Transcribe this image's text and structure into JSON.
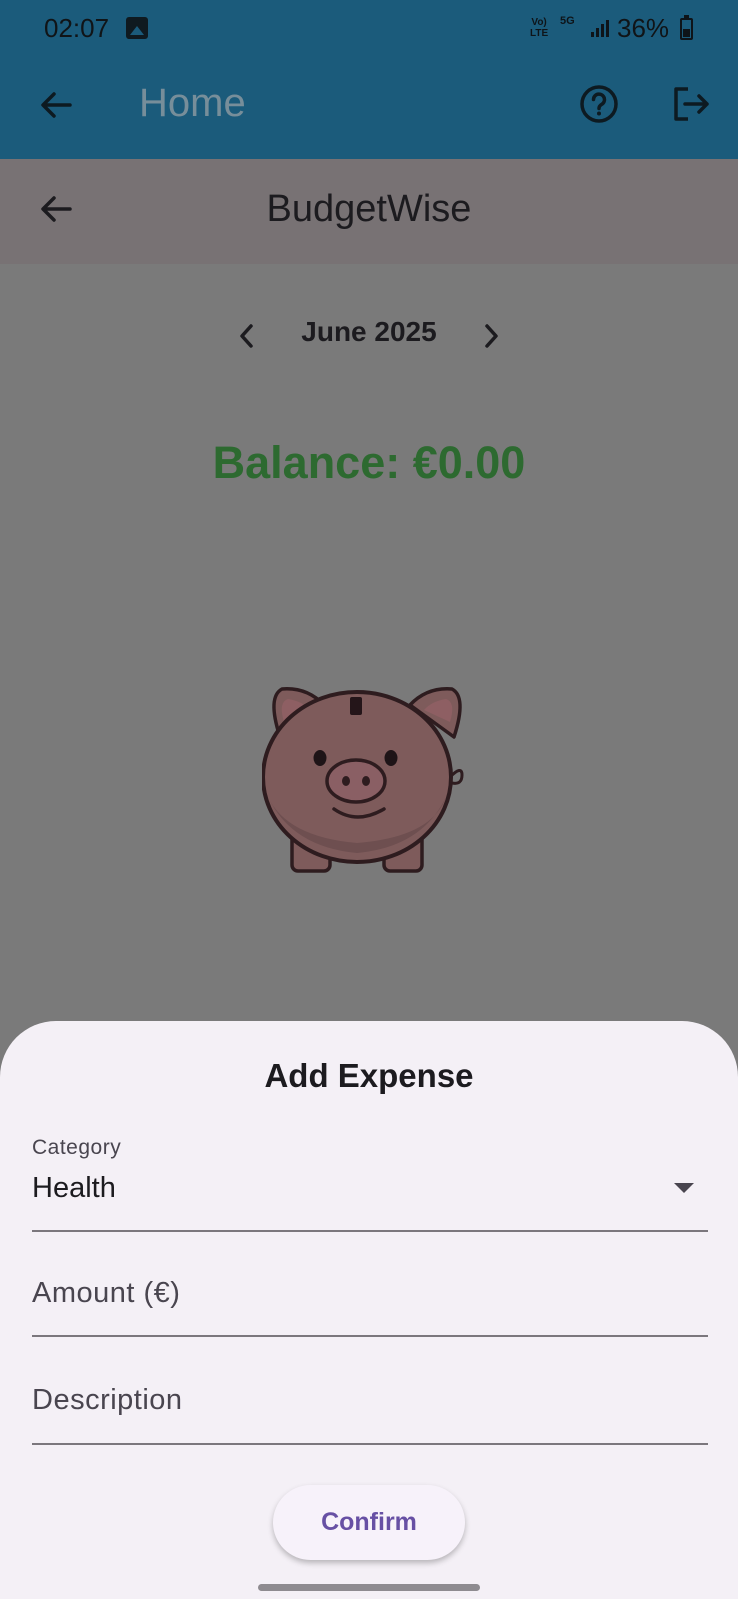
{
  "status_bar": {
    "time": "02:07",
    "network_volte": "Vo)\nLTE",
    "network_5g": "5G",
    "battery_percent": "36%"
  },
  "app_bar": {
    "title": "Home",
    "icons": [
      "back-arrow-icon",
      "help-circle-icon",
      "logout-icon"
    ]
  },
  "page": {
    "title": "BudgetWise",
    "month": "June 2025",
    "balance": "Balance: €0.00"
  },
  "sheet": {
    "title": "Add Expense",
    "category_label": "Category",
    "category_value": "Health",
    "amount_label": "Amount (€)",
    "description_label": "Description",
    "confirm_label": "Confirm"
  },
  "colors": {
    "app_bar": "#1b5b7b",
    "balance": "#2d6a30",
    "sheet_bg": "#f4f0f6",
    "button_text": "#6750a4"
  }
}
